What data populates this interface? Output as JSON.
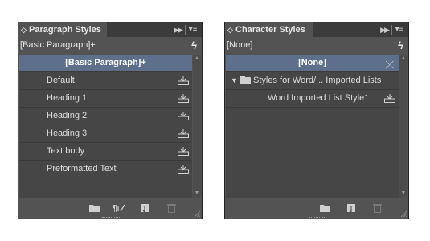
{
  "paragraph_panel": {
    "tab_label": "Paragraph Styles",
    "current_style": "[Basic Paragraph]+",
    "styles": [
      {
        "label": "[Basic Paragraph]+",
        "selected": true
      },
      {
        "label": "Default"
      },
      {
        "label": "Heading 1"
      },
      {
        "label": "Heading 2"
      },
      {
        "label": "Heading 3"
      },
      {
        "label": "Text body"
      },
      {
        "label": "Preformatted Text"
      }
    ],
    "bottom_icons": [
      "folder-icon",
      "clear-overrides-icon",
      "new-style-icon",
      "trash-icon"
    ]
  },
  "character_panel": {
    "tab_label": "Character Styles",
    "current_style": "[None]",
    "styles": [
      {
        "label": "[None]",
        "selected": true
      },
      {
        "label": "Styles for Word/... Imported Lists",
        "type": "group"
      },
      {
        "label": "Word Imported List Style1",
        "type": "child"
      }
    ],
    "bottom_icons": [
      "folder-icon",
      "new-style-icon",
      "trash-icon"
    ]
  },
  "colors": {
    "panel_bg": "#535353",
    "list_bg": "#464646",
    "tab_bar_bg": "#3b3b3b",
    "selected_row": "#5d6f8a",
    "text": "#dcdcdc"
  }
}
